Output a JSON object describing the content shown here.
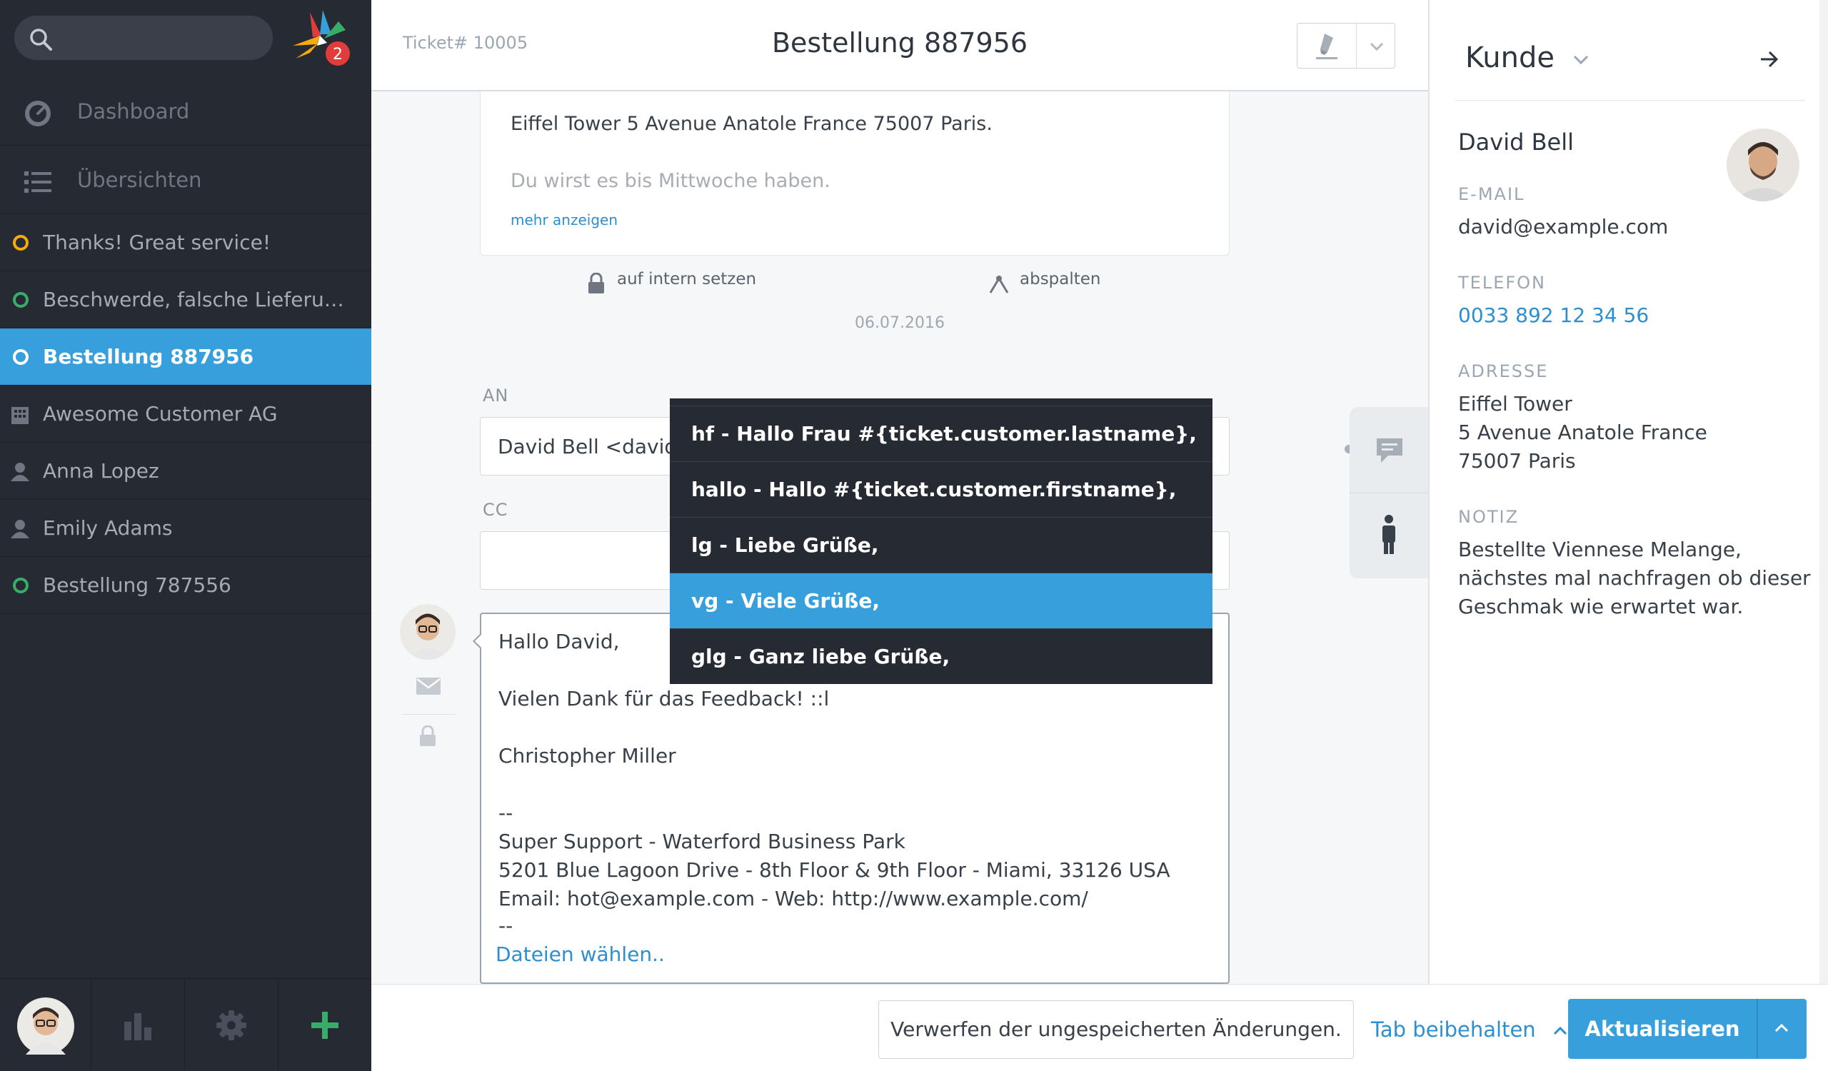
{
  "sidebar": {
    "badge_count": "2",
    "nav": [
      {
        "label": "Dashboard",
        "icon": "dashboard-icon"
      },
      {
        "label": "Übersichten",
        "icon": "list-icon"
      }
    ],
    "tickets": [
      {
        "label": "Thanks! Great service!",
        "icon": "ticket-open-icon",
        "color": "#f5ab0a"
      },
      {
        "label": "Beschwerde, falsche Lieferung ...",
        "icon": "ticket-open-icon",
        "color": "#38ad69"
      },
      {
        "label": "Bestellung 887956",
        "icon": "ticket-open-icon",
        "color": "#ffffff",
        "active": true
      },
      {
        "label": "Awesome Customer AG",
        "icon": "organization-icon"
      },
      {
        "label": "Anna Lopez",
        "icon": "user-icon"
      },
      {
        "label": "Emily Adams",
        "icon": "user-icon"
      },
      {
        "label": "Bestellung 787556",
        "icon": "ticket-open-icon",
        "color": "#38ad69"
      }
    ]
  },
  "header": {
    "ticket_number": "Ticket# 10005",
    "title": "Bestellung 887956"
  },
  "article": {
    "line1": "Eiffel Tower 5 Avenue Anatole France 75007 Paris.",
    "line2": "Du wirst es bis Mittwoche haben.",
    "more": "mehr anzeigen",
    "action_internal": "auf intern setzen",
    "action_split": "abspalten",
    "date": "06.07.2016"
  },
  "form": {
    "to_label": "AN",
    "to_value": "David Bell <david@",
    "cc_label": "CC",
    "cc_value": ""
  },
  "compose": {
    "lines": [
      "Hallo David,",
      "Vielen Dank für das Feedback! ::l",
      "Christopher Miller",
      "--",
      "Super Support - Waterford Business Park",
      "5201 Blue Lagoon Drive - 8th Floor & 9th Floor - Miami, 33126 USA",
      "Email: hot@example.com - Web: http://www.example.com/",
      "--"
    ],
    "files": "Dateien wählen.."
  },
  "dropdown": {
    "items": [
      "hf - Hallo Frau #{ticket.customer.lastname},",
      "hallo - Hallo #{ticket.customer.firstname},",
      "lg - Liebe Grüße,",
      "vg - Viele Grüße,",
      "glg - Ganz liebe Grüße,"
    ],
    "selected_index": 3
  },
  "footer": {
    "discard": "Verwerfen der ungespeicherten Änderungen.",
    "keep_tab": "Tab beibehalten",
    "update": "Aktualisieren"
  },
  "customer": {
    "title": "Kunde",
    "name": "David Bell",
    "email_label": "E-MAIL",
    "email": "david@example.com",
    "phone_label": "TELEFON",
    "phone": "0033 892 12 34 56",
    "address_label": "ADRESSE",
    "address": [
      "Eiffel Tower",
      "5 Avenue Anatole France",
      "75007 Paris"
    ],
    "note_label": "NOTIZ",
    "note": [
      "Bestellte Viennese Melange,",
      "nächstes mal nachfragen ob dieser",
      "Geschmak wie erwartet war."
    ]
  },
  "colors": {
    "accent": "#37a0dc",
    "sidebar_bg": "#262a33",
    "link": "#2c8fd0",
    "open_green": "#38ad69",
    "pending_orange": "#f5ab0a"
  }
}
